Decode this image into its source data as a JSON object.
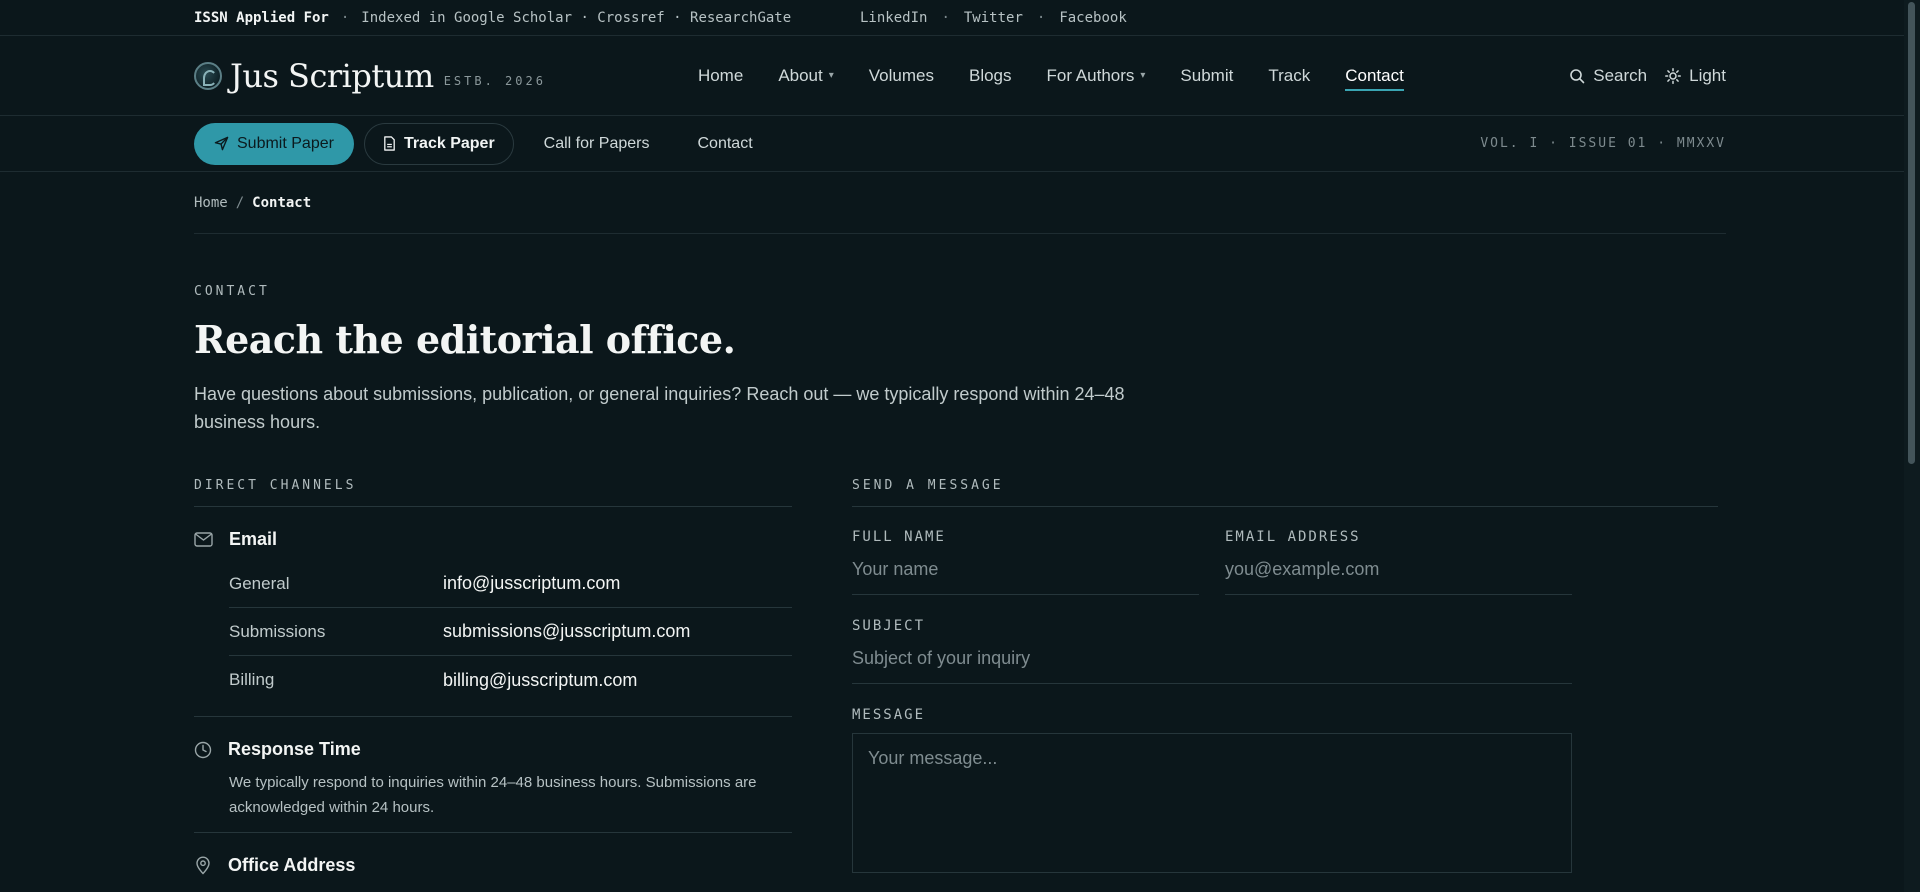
{
  "topbar": {
    "issn": "ISSN Applied For",
    "indexed": "Indexed in Google Scholar · Crossref · ResearchGate",
    "social": [
      "LinkedIn",
      "Twitter",
      "Facebook"
    ]
  },
  "brand": {
    "name": "Jus Scriptum",
    "estb": "ESTB. 2026"
  },
  "nav": {
    "items": [
      {
        "label": "Home"
      },
      {
        "label": "About"
      },
      {
        "label": "Volumes"
      },
      {
        "label": "Blogs"
      },
      {
        "label": "For Authors"
      },
      {
        "label": "Submit"
      },
      {
        "label": "Track"
      },
      {
        "label": "Contact"
      }
    ],
    "search_label": "Search",
    "theme_label": "Light"
  },
  "actions": {
    "submit_paper": "Submit Paper",
    "track_paper": "Track Paper",
    "call_for_papers": "Call for Papers",
    "contact": "Contact",
    "volume_info": "VOL. I · ISSUE 01 · MMXXV"
  },
  "breadcrumb": {
    "home": "Home",
    "separator": "/",
    "current": "Contact"
  },
  "hero": {
    "eyebrow": "CONTACT",
    "title": "Reach the editorial office.",
    "lead": "Have questions about submissions, publication, or general inquiries? Reach out — we typically respond within 24–48 business hours."
  },
  "channels": {
    "heading": "DIRECT CHANNELS",
    "email": {
      "title": "Email",
      "rows": [
        {
          "label": "General",
          "value": "info@jusscriptum.com"
        },
        {
          "label": "Submissions",
          "value": "submissions@jusscriptum.com"
        },
        {
          "label": "Billing",
          "value": "billing@jusscriptum.com"
        }
      ]
    },
    "response": {
      "title": "Response Time",
      "text": "We typically respond to inquiries within 24–48 business hours. Submissions are acknowledged within 24 hours."
    },
    "office": {
      "title": "Office Address"
    }
  },
  "form": {
    "heading": "SEND A MESSAGE",
    "full_name": {
      "label": "FULL NAME",
      "placeholder": "Your name"
    },
    "email": {
      "label": "EMAIL ADDRESS",
      "placeholder": "you@example.com"
    },
    "subject": {
      "label": "SUBJECT",
      "placeholder": "Subject of your inquiry"
    },
    "message": {
      "label": "MESSAGE",
      "placeholder": "Your message..."
    }
  },
  "colors": {
    "background": "#0b171b",
    "accent": "#2f98a8",
    "text": "#d9e2e3"
  }
}
